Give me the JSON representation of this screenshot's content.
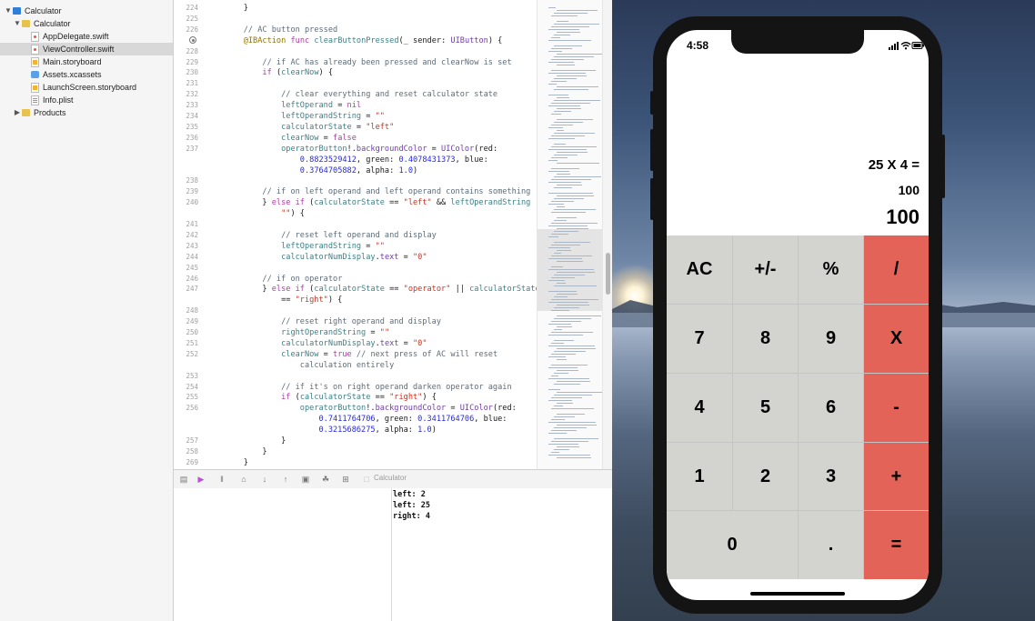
{
  "navigator": {
    "items": [
      {
        "label": "Calculator",
        "icon": "project-icon",
        "disclosure": "open"
      },
      {
        "label": "Calculator",
        "icon": "folder-icon",
        "disclosure": "open"
      },
      {
        "label": "AppDelegate.swift",
        "icon": "swift-file-icon"
      },
      {
        "label": "ViewController.swift",
        "icon": "swift-file-icon",
        "selected": true
      },
      {
        "label": "Main.storyboard",
        "icon": "storyboard-file-icon"
      },
      {
        "label": "Assets.xcassets",
        "icon": "asset-catalog-icon"
      },
      {
        "label": "LaunchScreen.storyboard",
        "icon": "storyboard-file-icon"
      },
      {
        "label": "Info.plist",
        "icon": "plist-file-icon"
      },
      {
        "label": "Products",
        "icon": "folder-icon",
        "disclosure": "closed"
      }
    ]
  },
  "editor": {
    "lines": [
      {
        "n": "224",
        "html": "    }"
      },
      {
        "n": "225",
        "html": ""
      },
      {
        "n": "226",
        "html": "    <span class=\"c-com\">// AC button pressed</span>"
      },
      {
        "n": "",
        "html": "    <span class=\"c-attr\">@IBAction</span> <span class=\"c-kw\">func</span> <span class=\"c-id\">clearButtonPressed</span>(_ sender: <span class=\"c-type\">UIButton</span>) {"
      },
      {
        "n": "228",
        "html": ""
      },
      {
        "n": "229",
        "html": "        <span class=\"c-com\">// if AC has already been pressed and clearNow is set</span>"
      },
      {
        "n": "230",
        "html": "        <span class=\"c-kw\">if</span> (<span class=\"c-id\">clearNow</span>) {"
      },
      {
        "n": "231",
        "html": ""
      },
      {
        "n": "232",
        "html": "            <span class=\"c-com\">// clear everything and reset calculator state</span>"
      },
      {
        "n": "233",
        "html": "            <span class=\"c-id\">leftOperand</span> = <span class=\"c-kw\">nil</span>"
      },
      {
        "n": "234",
        "html": "            <span class=\"c-id\">leftOperandString</span> = <span class=\"c-str\">\"\"</span>"
      },
      {
        "n": "235",
        "html": "            <span class=\"c-id\">calculatorState</span> = <span class=\"c-str\">\"left\"</span>"
      },
      {
        "n": "236",
        "html": "            <span class=\"c-id\">clearNow</span> = <span class=\"c-kw\">false</span>"
      },
      {
        "n": "237",
        "html": "            <span class=\"c-id\">operatorButton</span>!.<span class=\"c-type\">backgroundColor</span> = <span class=\"c-type\">UIColor</span>(red:"
      },
      {
        "n": "",
        "html": "                <span class=\"c-num\">0.8823529412</span>, green: <span class=\"c-num\">0.4078431373</span>, blue:"
      },
      {
        "n": "",
        "html": "                <span class=\"c-num\">0.3764705882</span>, alpha: <span class=\"c-num\">1.0</span>)"
      },
      {
        "n": "238",
        "html": ""
      },
      {
        "n": "239",
        "html": "        <span class=\"c-com\">// if on left operand and left operand contains something</span>"
      },
      {
        "n": "240",
        "html": "        } <span class=\"c-kw\">else if</span> (<span class=\"c-id\">calculatorState</span> == <span class=\"c-str\">\"left\"</span> &amp;&amp; <span class=\"c-id\">leftOperandString</span> !="
      },
      {
        "n": "",
        "html": "            <span class=\"c-str\">\"\"</span>) {"
      },
      {
        "n": "241",
        "html": ""
      },
      {
        "n": "242",
        "html": "            <span class=\"c-com\">// reset left operand and display</span>"
      },
      {
        "n": "243",
        "html": "            <span class=\"c-id\">leftOperandString</span> = <span class=\"c-str\">\"\"</span>"
      },
      {
        "n": "244",
        "html": "            <span class=\"c-id\">calculatorNumDisplay</span>.<span class=\"c-type\">text</span> = <span class=\"c-str\">\"0\"</span>"
      },
      {
        "n": "245",
        "html": ""
      },
      {
        "n": "246",
        "html": "        <span class=\"c-com\">// if on operator</span>"
      },
      {
        "n": "247",
        "html": "        } <span class=\"c-kw\">else if</span> (<span class=\"c-id\">calculatorState</span> == <span class=\"c-str\">\"operator\"</span> || <span class=\"c-id\">calculatorState</span>"
      },
      {
        "n": "",
        "html": "            == <span class=\"c-str\">\"right\"</span>) {"
      },
      {
        "n": "248",
        "html": ""
      },
      {
        "n": "249",
        "html": "            <span class=\"c-com\">// reset right operand and display</span>"
      },
      {
        "n": "250",
        "html": "            <span class=\"c-id\">rightOperandString</span> = <span class=\"c-str\">\"\"</span>"
      },
      {
        "n": "251",
        "html": "            <span class=\"c-id\">calculatorNumDisplay</span>.<span class=\"c-type\">text</span> = <span class=\"c-str\">\"0\"</span>"
      },
      {
        "n": "252",
        "html": "            <span class=\"c-id\">clearNow</span> = <span class=\"c-kw\">true</span> <span class=\"c-com\">// next press of AC will reset</span>"
      },
      {
        "n": "",
        "html": "                <span class=\"c-com\">calculation entirely</span>"
      },
      {
        "n": "253",
        "html": ""
      },
      {
        "n": "254",
        "html": "            <span class=\"c-com\">// if it's on right operand darken operator again</span>"
      },
      {
        "n": "255",
        "html": "            <span class=\"c-kw\">if</span> (<span class=\"c-id\">calculatorState</span> == <span class=\"c-str\">\"right\"</span>) {"
      },
      {
        "n": "256",
        "html": "                <span class=\"c-id\">operatorButton</span>!.<span class=\"c-type\">backgroundColor</span> = <span class=\"c-type\">UIColor</span>(red:"
      },
      {
        "n": "",
        "html": "                    <span class=\"c-num\">0.7411764706</span>, green: <span class=\"c-num\">0.3411764706</span>, blue:"
      },
      {
        "n": "",
        "html": "                    <span class=\"c-num\">0.3215686275</span>, alpha: <span class=\"c-num\">1.0</span>)"
      },
      {
        "n": "257",
        "html": "            }"
      },
      {
        "n": "258",
        "html": "        }"
      },
      {
        "n": "269",
        "html": "    }"
      }
    ]
  },
  "debug_bar": {
    "target_label": "Calculator",
    "icons": [
      "debug-area-toggle-icon",
      "breakpoints-toggle-icon",
      "pause-icon",
      "step-over-icon",
      "step-into-icon",
      "step-out-icon",
      "view-debugger-icon",
      "memory-graph-icon",
      "simulate-location-icon"
    ]
  },
  "console": {
    "lines": [
      "left: 2",
      "left: 25",
      "right: 4"
    ]
  },
  "simulator": {
    "time": "4:58",
    "expression": "25 X 4 =",
    "result": "100",
    "display": "100",
    "keys": [
      {
        "label": "AC",
        "type": "function"
      },
      {
        "label": "+/-",
        "type": "function"
      },
      {
        "label": "%",
        "type": "function"
      },
      {
        "label": "/",
        "type": "operator"
      },
      {
        "label": "7",
        "type": "digit"
      },
      {
        "label": "8",
        "type": "digit"
      },
      {
        "label": "9",
        "type": "digit"
      },
      {
        "label": "X",
        "type": "operator"
      },
      {
        "label": "4",
        "type": "digit"
      },
      {
        "label": "5",
        "type": "digit"
      },
      {
        "label": "6",
        "type": "digit"
      },
      {
        "label": "-",
        "type": "operator"
      },
      {
        "label": "1",
        "type": "digit"
      },
      {
        "label": "2",
        "type": "digit"
      },
      {
        "label": "3",
        "type": "digit"
      },
      {
        "label": "+",
        "type": "operator"
      },
      {
        "label": "0",
        "type": "digit"
      },
      {
        "label": ".",
        "type": "digit"
      },
      {
        "label": "=",
        "type": "operator"
      }
    ]
  },
  "colors": {
    "operator_key": "#e46358",
    "function_key": "#d3d3cf",
    "selected_row": "#d8d8d8"
  }
}
